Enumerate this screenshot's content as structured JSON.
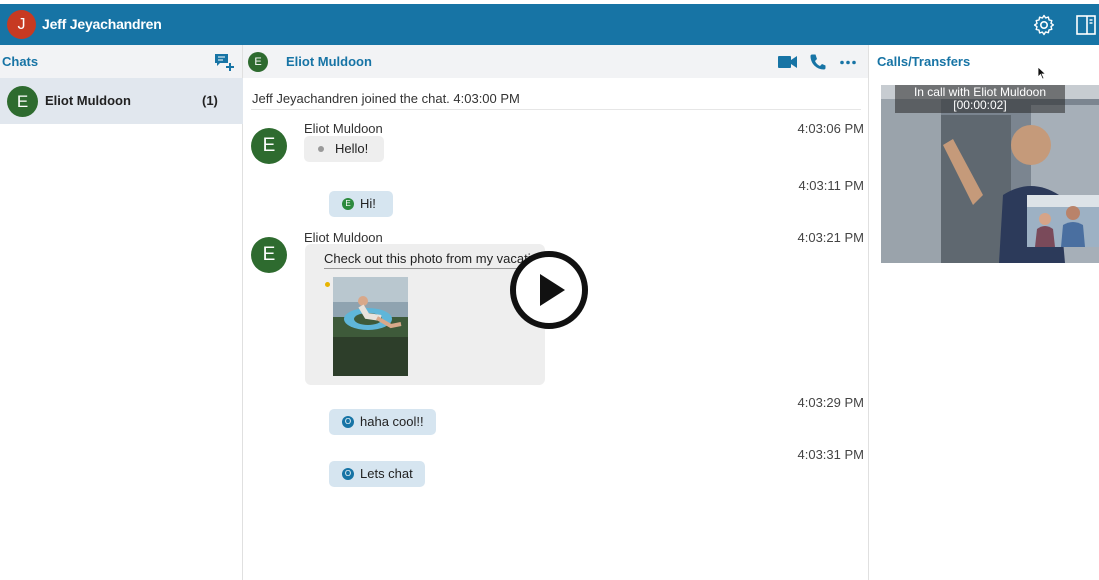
{
  "header": {
    "user_initial": "J",
    "user_name": "Jeff Jeyachandren",
    "settings_icon": "gear-icon",
    "layout_icon": "panel-toggle-icon"
  },
  "sidebar": {
    "title": "Chats",
    "new_chat_icon": "new-chat-icon",
    "items": [
      {
        "initial": "E",
        "name": "Eliot Muldoon",
        "count": "(1)"
      }
    ]
  },
  "conversation": {
    "contact_initial": "E",
    "contact_name": "Eliot Muldoon",
    "icons": [
      "video-call-icon",
      "phone-icon",
      "more-icon"
    ],
    "system_message": "Jeff Jeyachandren joined the chat. 4:03:00 PM",
    "messages": [
      {
        "sender": "Eliot Muldoon",
        "initial": "E",
        "text": "Hello!",
        "time": "4:03:06 PM",
        "direction": "in"
      },
      {
        "text": "Hi!",
        "time": "4:03:11 PM",
        "direction": "out",
        "badge": "E"
      },
      {
        "sender": "Eliot Muldoon",
        "initial": "E",
        "text": "Check out this photo from my vacatio",
        "time": "4:03:21 PM",
        "direction": "in",
        "has_photo": true
      },
      {
        "text": "haha cool!!",
        "time": "4:03:29 PM",
        "direction": "out",
        "badge": "O"
      },
      {
        "text": "Lets chat",
        "time": "4:03:31 PM",
        "direction": "out",
        "badge": "O"
      }
    ]
  },
  "calls_panel": {
    "title": "Calls/Transfers",
    "status": "In call with Eliot Muldoon",
    "timer": "[00:00:02]"
  },
  "colors": {
    "brand": "#1774a5",
    "avatar_green": "#2e6b2f",
    "user_avatar": "#c73a22",
    "sent_bubble": "#d6e5f0",
    "received_bubble": "#eeeeee"
  }
}
